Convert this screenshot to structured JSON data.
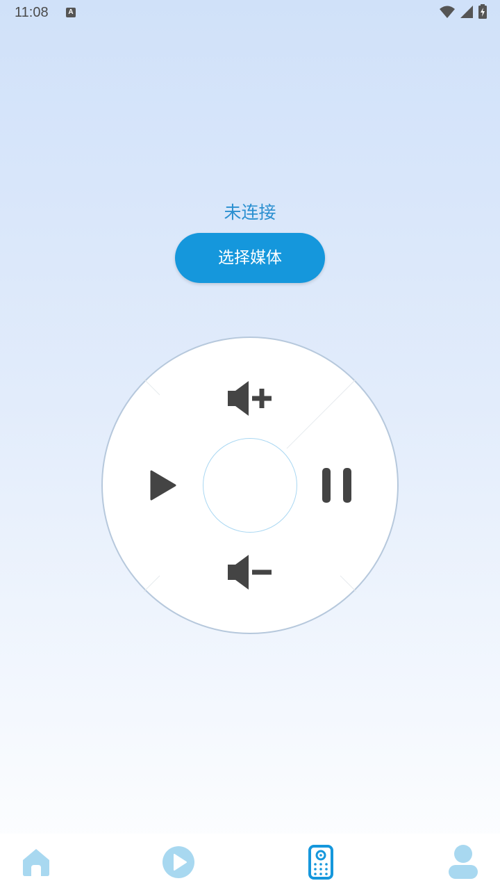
{
  "status_bar": {
    "time": "11:08",
    "notification_icon_letter": "A",
    "icons": [
      "wifi-icon",
      "cellular-signal-icon",
      "battery-charging-icon"
    ]
  },
  "main": {
    "connection_status": "未连接",
    "select_media_label": "选择媒体"
  },
  "remote": {
    "buttons": [
      "volume-up-icon",
      "volume-down-icon",
      "play-icon",
      "pause-icon",
      "ok-button"
    ],
    "icon_color": "#444444"
  },
  "bottom_nav": {
    "items": [
      {
        "icon": "home-icon",
        "active": false
      },
      {
        "icon": "play-circle-icon",
        "active": false
      },
      {
        "icon": "remote-control-icon",
        "active": true
      },
      {
        "icon": "profile-icon",
        "active": false
      }
    ],
    "active_color": "#1597dc",
    "inactive_color": "#a8d8f0"
  },
  "colors": {
    "accent": "#1597dc",
    "status_text": "#2a8fd0"
  }
}
